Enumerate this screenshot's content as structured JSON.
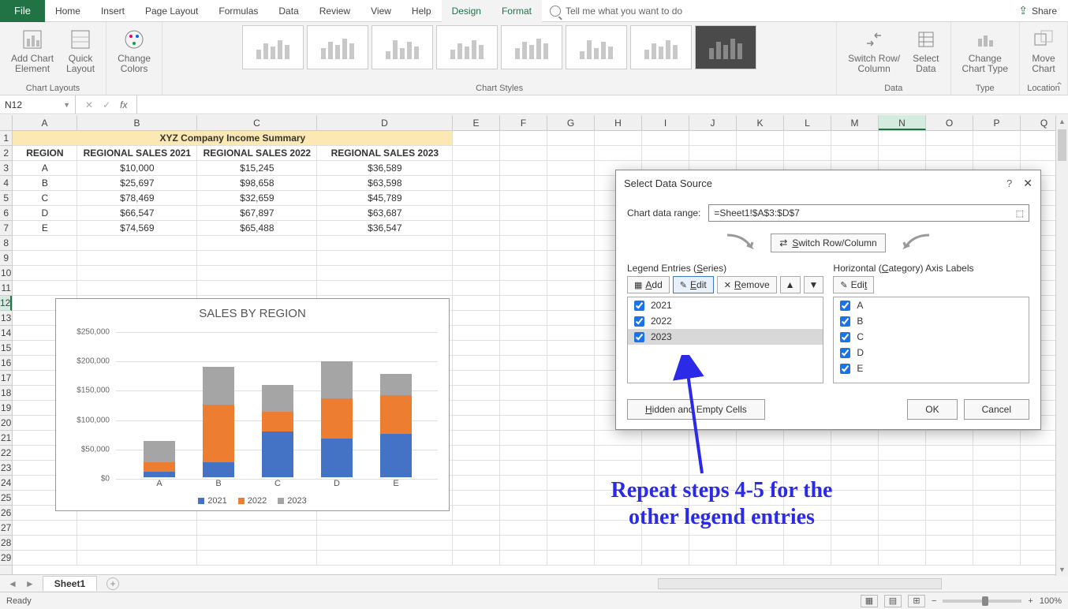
{
  "tabs": {
    "file": "File",
    "list": [
      "Home",
      "Insert",
      "Page Layout",
      "Formulas",
      "Data",
      "Review",
      "View",
      "Help",
      "Design",
      "Format"
    ],
    "active_indices": [
      8,
      9
    ],
    "tellme": "Tell me what you want to do",
    "share": "Share"
  },
  "ribbon": {
    "chart_layouts": {
      "label": "Chart Layouts",
      "add_element": "Add Chart\nElement",
      "quick_layout": "Quick\nLayout"
    },
    "change_colors": "Change\nColors",
    "chart_styles_label": "Chart Styles",
    "data": {
      "label": "Data",
      "switch": "Switch Row/\nColumn",
      "select": "Select\nData"
    },
    "type": {
      "label": "Type",
      "change": "Change\nChart Type"
    },
    "location": {
      "label": "Location",
      "move": "Move\nChart"
    }
  },
  "namebox": "N12",
  "fx_label": "fx",
  "columns": [
    "A",
    "B",
    "C",
    "D",
    "E",
    "F",
    "G",
    "H",
    "I",
    "J",
    "K",
    "L",
    "M",
    "N",
    "O",
    "P",
    "Q"
  ],
  "sheet": {
    "title": "XYZ Company Income Summary",
    "headers": [
      "REGION",
      "REGIONAL SALES 2021",
      "REGIONAL SALES 2022",
      "REGIONAL SALES 2023"
    ],
    "rows": [
      [
        "A",
        "$10,000",
        "$15,245",
        "$36,589"
      ],
      [
        "B",
        "$25,697",
        "$98,658",
        "$63,598"
      ],
      [
        "C",
        "$78,469",
        "$32,659",
        "$45,789"
      ],
      [
        "D",
        "$66,547",
        "$67,897",
        "$63,687"
      ],
      [
        "E",
        "$74,569",
        "$65,488",
        "$36,547"
      ]
    ]
  },
  "embedded_chart_title": "SALES BY REGION",
  "chart_data": {
    "type": "bar",
    "stacked": true,
    "title": "SALES BY REGION",
    "categories": [
      "A",
      "B",
      "C",
      "D",
      "E"
    ],
    "series": [
      {
        "name": "2021",
        "values": [
          10000,
          25697,
          78469,
          66547,
          74569
        ],
        "color": "#4472c4"
      },
      {
        "name": "2022",
        "values": [
          15245,
          98658,
          32659,
          67897,
          65488
        ],
        "color": "#ed7d31"
      },
      {
        "name": "2023",
        "values": [
          36589,
          63598,
          45789,
          63687,
          36547
        ],
        "color": "#a5a5a5"
      }
    ],
    "xlabel": "",
    "ylabel": "",
    "ylim": [
      0,
      250000
    ],
    "yticks": [
      "$0",
      "$50,000",
      "$100,000",
      "$150,000",
      "$200,000",
      "$250,000"
    ]
  },
  "dialog": {
    "title": "Select Data Source",
    "help": "?",
    "range_label": "Chart data range:",
    "range_value": "=Sheet1!$A$3:$D$7",
    "switch_btn": "Switch Row/Column",
    "legend_title": "Legend Entries (Series)",
    "legend_buttons": {
      "add": "Add",
      "edit": "Edit",
      "remove": "Remove"
    },
    "legend_items": [
      "2021",
      "2022",
      "2023"
    ],
    "legend_selected_index": 2,
    "axis_title": "Horizontal (Category) Axis Labels",
    "axis_edit": "Edit",
    "axis_items": [
      "A",
      "B",
      "C",
      "D",
      "E"
    ],
    "hidden_cells": "Hidden and Empty Cells",
    "ok": "OK",
    "cancel": "Cancel"
  },
  "annotation": "Repeat steps 4-5 for the\nother legend entries",
  "sheet_tab": "Sheet1",
  "status": {
    "ready": "Ready",
    "zoom": "100%"
  }
}
